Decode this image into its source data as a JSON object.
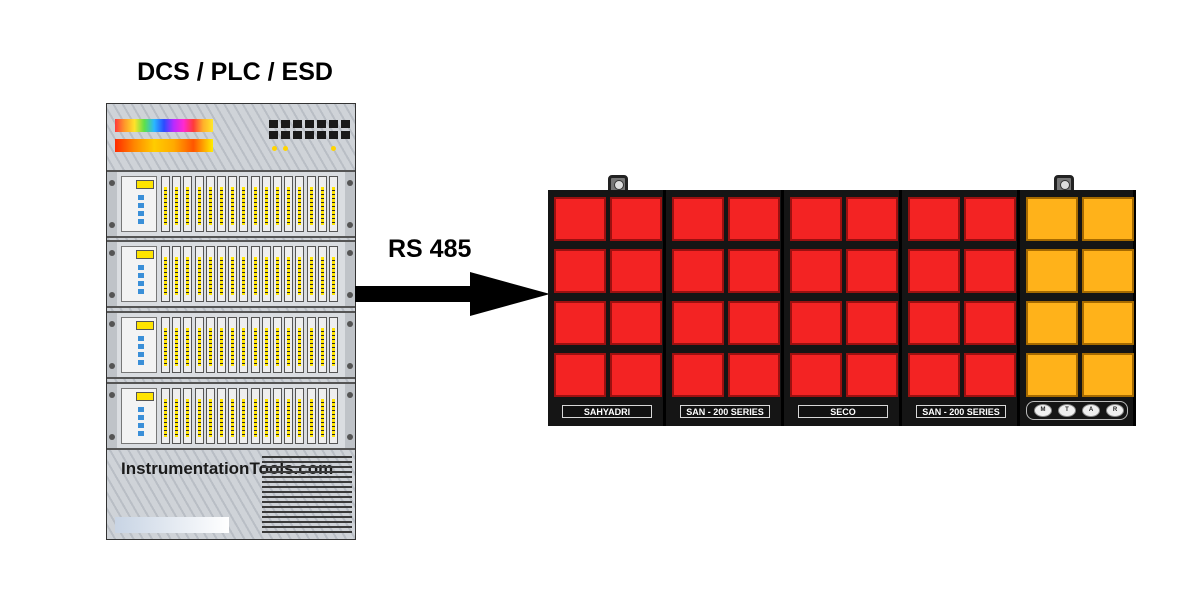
{
  "cabinet": {
    "title": "DCS / PLC / ESD",
    "watermark": "InstrumentationTools.com"
  },
  "link": {
    "label": "RS 485"
  },
  "annunciator": {
    "modules": [
      {
        "plate": "SAHYADRI",
        "color": "red"
      },
      {
        "plate": "SAN - 200 SERIES",
        "color": "red"
      },
      {
        "plate": "SECO",
        "color": "red"
      },
      {
        "plate": "SAN - 200 SERIES",
        "color": "red"
      },
      {
        "buttons": [
          "M",
          "T",
          "A",
          "R"
        ],
        "color": "amber"
      }
    ],
    "colors": {
      "red": "#f32323",
      "amber": "#ffb21a",
      "frame": "#111111"
    }
  }
}
